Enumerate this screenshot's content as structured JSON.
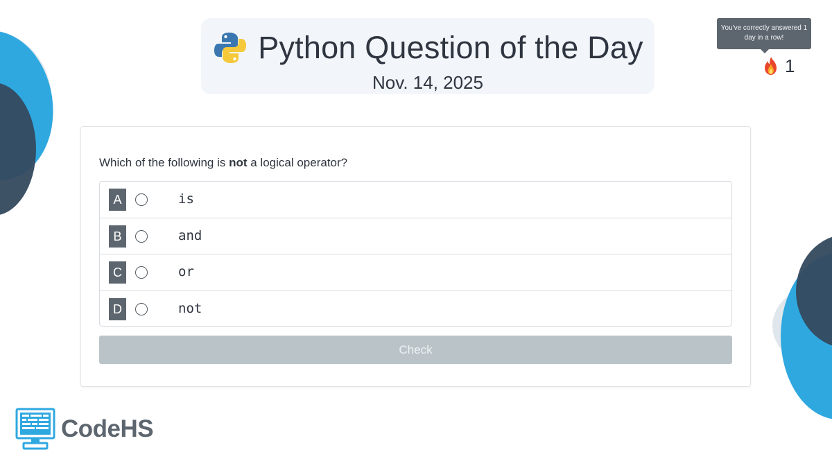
{
  "header": {
    "title": "Python Question of the Day",
    "date": "Nov. 14, 2025",
    "logo_icon": "python-logo-icon"
  },
  "streak": {
    "tooltip": "You've correctly answered 1 day in a row!",
    "icon": "flame-icon",
    "count": "1"
  },
  "quiz": {
    "question_prefix": "Which of the following is ",
    "question_emphasis": "not",
    "question_suffix": " a logical operator?",
    "options": [
      {
        "letter": "A",
        "code": "is",
        "selected": false
      },
      {
        "letter": "B",
        "code": "and",
        "selected": false
      },
      {
        "letter": "C",
        "code": "or",
        "selected": false
      },
      {
        "letter": "D",
        "code": "not",
        "selected": false
      }
    ],
    "check_label": "Check",
    "check_enabled": false
  },
  "brand": {
    "name": "CodeHS",
    "icon": "computer-monitor-icon"
  },
  "colors": {
    "accent_blue": "#2fa8e0",
    "slate": "#5d666f",
    "dark_navy": "#34495e",
    "button_disabled": "#bac4c8",
    "title_card_bg": "#f2f6fa"
  }
}
